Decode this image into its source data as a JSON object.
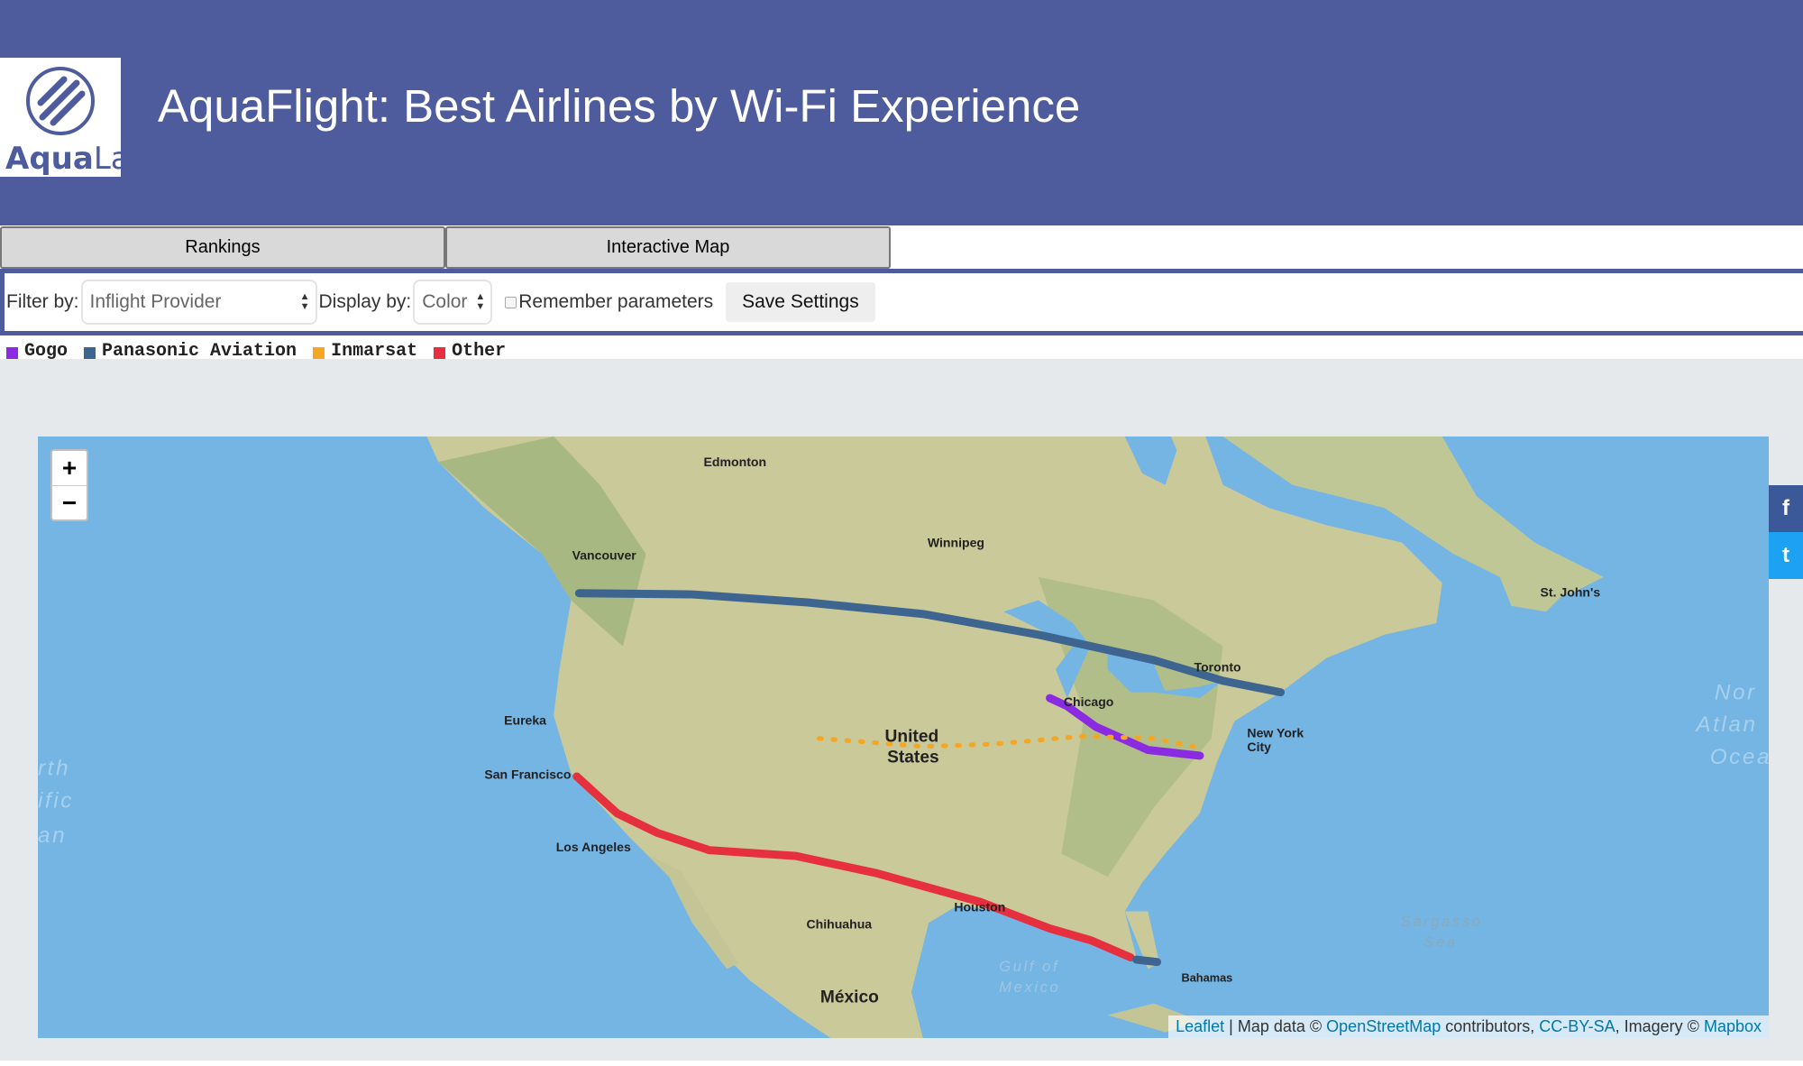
{
  "header": {
    "title": "AquaFlight: Best Airlines by Wi-Fi Experience",
    "logo_text_bold": "Aqua",
    "logo_text_light": "Lab"
  },
  "tabs": [
    {
      "label": "Rankings"
    },
    {
      "label": "Interactive Map"
    }
  ],
  "filter": {
    "filter_label": "Filter by:",
    "filter_value": "Inflight Provider",
    "display_label": "Display by:",
    "display_value": "Color",
    "remember_label": "Remember parameters",
    "save_label": "Save Settings"
  },
  "legend": [
    {
      "label": "Gogo",
      "color": "#8a2be2"
    },
    {
      "label": "Panasonic Aviation",
      "color": "#3d6590"
    },
    {
      "label": "Inmarsat",
      "color": "#f5a623"
    },
    {
      "label": "Other",
      "color": "#e6303f"
    }
  ],
  "map": {
    "zoom_in": "+",
    "zoom_out": "−",
    "labels": {
      "edmonton": "Edmonton",
      "winnipeg": "Winnipeg",
      "vancouver": "Vancouver",
      "stjohns": "St. John's",
      "eureka": "Eureka",
      "sf": "San Francisco",
      "la": "Los Angeles",
      "chicago": "Chicago",
      "toronto": "Toronto",
      "ny1": "New York",
      "ny2": "City",
      "us1": "United",
      "us2": "States",
      "houston": "Houston",
      "chihuahua": "Chihuahua",
      "mexico": "México",
      "bahamas": "Bahamas",
      "gulf1": "Gulf of",
      "gulf2": "Mexico",
      "sargasso1": "Sargasso",
      "sargasso2": "Sea",
      "natl1": "Nor",
      "natl2": "Atlan",
      "natl3": "Ocea",
      "npac1": "rth",
      "npac2": "ific",
      "npac3": "an"
    },
    "attribution": {
      "leaflet": "Leaflet",
      "sep": " | Map data © ",
      "osm": "OpenStreetMap",
      "contrib": " contributors, ",
      "cc": "CC-BY-SA",
      "imagery": ", Imagery © ",
      "mapbox": "Mapbox"
    }
  },
  "social": {
    "facebook": "f",
    "twitter": "t"
  }
}
